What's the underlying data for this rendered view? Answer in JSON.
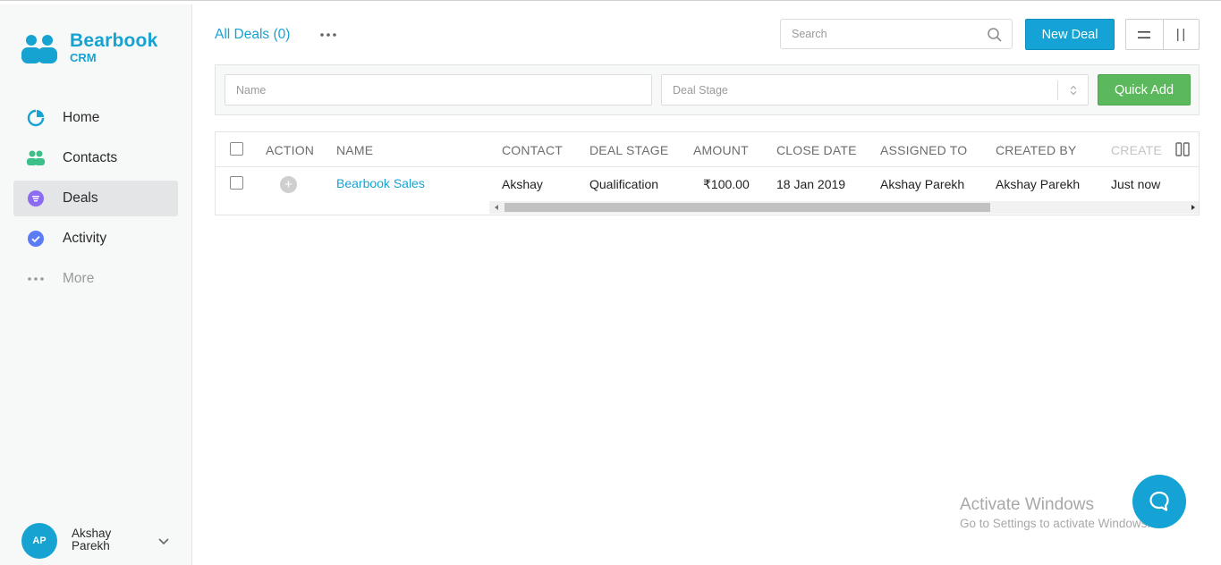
{
  "brand": {
    "name": "Bearbook",
    "sub": "CRM",
    "color": "#17a3d1"
  },
  "sidebar": {
    "items": [
      {
        "label": "Home",
        "icon": "pie-chart-icon",
        "active": false
      },
      {
        "label": "Contacts",
        "icon": "people-icon",
        "active": false
      },
      {
        "label": "Deals",
        "icon": "filter-list-icon",
        "active": true
      },
      {
        "label": "Activity",
        "icon": "check-circle-icon",
        "active": false
      },
      {
        "label": "More",
        "icon": "more-dots-icon",
        "active": false
      }
    ]
  },
  "user": {
    "initials": "AP",
    "name": "Akshay Parekh"
  },
  "header": {
    "title": "All Deals (0)",
    "search_placeholder": "Search",
    "new_deal_label": "New Deal"
  },
  "filters": {
    "name_placeholder": "Name",
    "stage_placeholder": "Deal Stage",
    "quick_add_label": "Quick Add"
  },
  "table": {
    "columns": [
      "ACTION",
      "NAME",
      "CONTACT",
      "DEAL STAGE",
      "AMOUNT",
      "CLOSE DATE",
      "ASSIGNED TO",
      "CREATED BY",
      "CREATED"
    ],
    "rows": [
      {
        "name": "Bearbook Sales",
        "contact": "Akshay",
        "deal_stage": "Qualification",
        "amount": "₹100.00",
        "close_date": "18 Jan 2019",
        "assigned_to": "Akshay Parekh",
        "created_by": "Akshay Parekh",
        "created": "Just now"
      }
    ]
  },
  "watermark": {
    "title": "Activate Windows",
    "subtitle": "Go to Settings to activate Windows."
  },
  "colors": {
    "primary": "#14a3d4",
    "success": "#5cb85c",
    "deals_icon": "#8b6cf0",
    "activity_icon": "#5b7cf5",
    "contacts_icon": "#3dbf8a"
  }
}
